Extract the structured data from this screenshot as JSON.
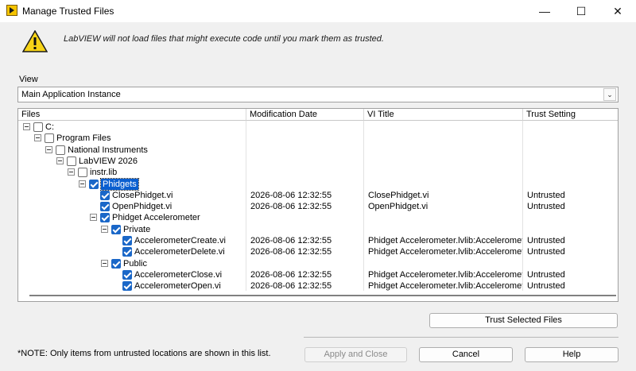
{
  "window": {
    "title": "Manage Trusted Files",
    "minimize_glyph": "—",
    "maximize_glyph": "☐",
    "close_glyph": "✕",
    "app_icon": "labview-icon"
  },
  "warning": {
    "icon": "warning-icon",
    "message": "LabVIEW will not load files that might execute code until you mark them as trusted."
  },
  "view": {
    "label": "View",
    "selected": "Main Application Instance"
  },
  "table": {
    "columns": [
      "Files",
      "Modification Date",
      "VI Title",
      "Trust Setting"
    ],
    "rows": [
      {
        "name": "C:",
        "level": 0,
        "expandable": true,
        "checked": false,
        "selected": false,
        "date": "",
        "vi_title": "",
        "trust": ""
      },
      {
        "name": "Program Files",
        "level": 1,
        "expandable": true,
        "checked": false,
        "selected": false,
        "date": "",
        "vi_title": "",
        "trust": ""
      },
      {
        "name": "National Instruments",
        "level": 2,
        "expandable": true,
        "checked": false,
        "selected": false,
        "date": "",
        "vi_title": "",
        "trust": ""
      },
      {
        "name": "LabVIEW 2026",
        "level": 3,
        "expandable": true,
        "checked": false,
        "selected": false,
        "date": "",
        "vi_title": "",
        "trust": ""
      },
      {
        "name": "instr.lib",
        "level": 4,
        "expandable": true,
        "checked": false,
        "selected": false,
        "date": "",
        "vi_title": "",
        "trust": ""
      },
      {
        "name": "Phidgets",
        "level": 5,
        "expandable": true,
        "checked": true,
        "selected": true,
        "date": "",
        "vi_title": "",
        "trust": ""
      },
      {
        "name": "ClosePhidget.vi",
        "level": 6,
        "expandable": false,
        "checked": true,
        "selected": false,
        "date": "2026-08-06 12:32:55",
        "vi_title": "ClosePhidget.vi",
        "trust": "Untrusted"
      },
      {
        "name": "OpenPhidget.vi",
        "level": 6,
        "expandable": false,
        "checked": true,
        "selected": false,
        "date": "2026-08-06 12:32:55",
        "vi_title": "OpenPhidget.vi",
        "trust": "Untrusted"
      },
      {
        "name": "Phidget Accelerometer",
        "level": 6,
        "expandable": true,
        "checked": true,
        "selected": false,
        "date": "",
        "vi_title": "",
        "trust": ""
      },
      {
        "name": "Private",
        "level": 7,
        "expandable": true,
        "checked": true,
        "selected": false,
        "date": "",
        "vi_title": "",
        "trust": ""
      },
      {
        "name": "AccelerometerCreate.vi",
        "level": 8,
        "expandable": false,
        "checked": true,
        "selected": false,
        "date": "2026-08-06 12:32:55",
        "vi_title": "Phidget Accelerometer.lvlib:Acceleromet",
        "trust": "Untrusted"
      },
      {
        "name": "AccelerometerDelete.vi",
        "level": 8,
        "expandable": false,
        "checked": true,
        "selected": false,
        "date": "2026-08-06 12:32:55",
        "vi_title": "Phidget Accelerometer.lvlib:Acceleromet",
        "trust": "Untrusted"
      },
      {
        "name": "Public",
        "level": 7,
        "expandable": true,
        "checked": true,
        "selected": false,
        "date": "",
        "vi_title": "",
        "trust": ""
      },
      {
        "name": "AccelerometerClose.vi",
        "level": 8,
        "expandable": false,
        "checked": true,
        "selected": false,
        "date": "2026-08-06 12:32:55",
        "vi_title": "Phidget Accelerometer.lvlib:Acceleromet",
        "trust": "Untrusted"
      },
      {
        "name": "AccelerometerOpen.vi",
        "level": 8,
        "expandable": false,
        "checked": true,
        "selected": false,
        "date": "2026-08-06 12:32:55",
        "vi_title": "Phidget Accelerometer.lvlib:Acceleromet",
        "trust": "Untrusted"
      }
    ]
  },
  "buttons": {
    "trust_selected": "Trust Selected Files",
    "apply_close": "Apply and Close",
    "cancel": "Cancel",
    "help": "Help"
  },
  "note": "*NOTE: Only items from untrusted locations are shown in this list.",
  "colors": {
    "selection": "#0a5fd0",
    "checkbox_on": "#1a67c8",
    "warning_yellow": "#f7d417"
  }
}
